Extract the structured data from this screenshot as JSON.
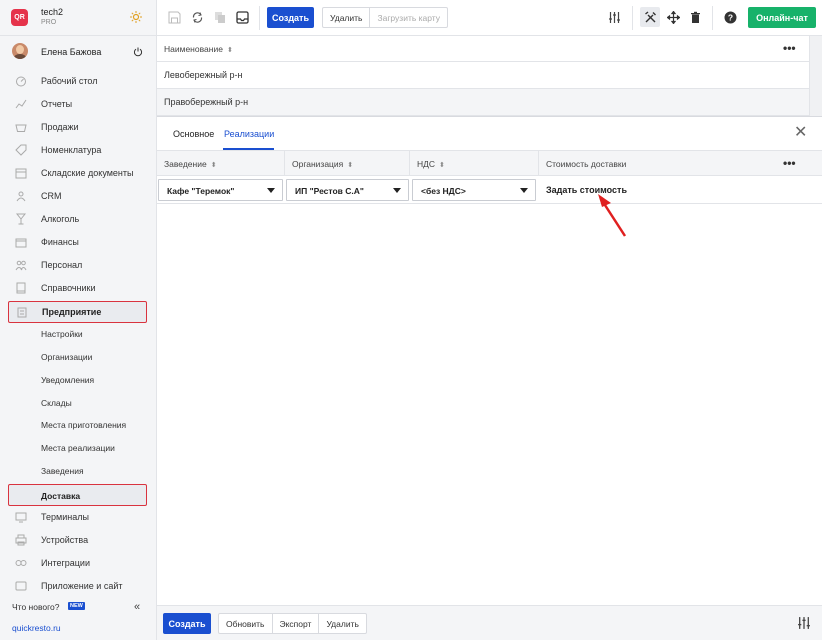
{
  "brand": {
    "logo_text": "QR",
    "name": "tech2",
    "plan": "PRO"
  },
  "user": {
    "name": "Елена Бажова"
  },
  "sidebar": {
    "items": [
      {
        "label": "Рабочий стол",
        "icon": "dashboard-icon"
      },
      {
        "label": "Отчеты",
        "icon": "reports-icon"
      },
      {
        "label": "Продажи",
        "icon": "basket-icon"
      },
      {
        "label": "Номенклатура",
        "icon": "tag-icon"
      },
      {
        "label": "Складские документы",
        "icon": "warehouse-icon"
      },
      {
        "label": "CRM",
        "icon": "people-icon"
      },
      {
        "label": "Алкоголь",
        "icon": "glass-icon"
      },
      {
        "label": "Финансы",
        "icon": "wallet-icon"
      },
      {
        "label": "Персонал",
        "icon": "staff-icon"
      },
      {
        "label": "Справочники",
        "icon": "book-icon"
      },
      {
        "label": "Предприятие",
        "icon": "building-icon"
      }
    ],
    "subitems": [
      {
        "label": "Настройки"
      },
      {
        "label": "Организации"
      },
      {
        "label": "Уведомления"
      },
      {
        "label": "Склады"
      },
      {
        "label": "Места приготовления"
      },
      {
        "label": "Места реализации"
      },
      {
        "label": "Заведения"
      },
      {
        "label": "Доставка"
      }
    ],
    "bottom_items": [
      {
        "label": "Терминалы",
        "icon": "terminal-icon"
      },
      {
        "label": "Устройства",
        "icon": "printer-icon"
      },
      {
        "label": "Интеграции",
        "icon": "link-icon"
      },
      {
        "label": "Приложение и сайт",
        "icon": "app-icon"
      }
    ],
    "whats_new": "Что нового?",
    "new_badge": "NEW",
    "site_link": "quickresto.ru"
  },
  "toolbar": {
    "create_label": "Создать",
    "delete_label": "Удалить",
    "upload_map_label": "Загрузить карту",
    "chat_label": "Онлайн-чат"
  },
  "list": {
    "column_header": "Наименование",
    "rows": [
      "Левобережный р-н",
      "Правобережный р-н"
    ]
  },
  "detail": {
    "tabs": [
      "Основное",
      "Реализации"
    ],
    "active_tab": "Реализации",
    "columns": [
      "Заведение",
      "Организация",
      "НДС",
      "Стоимость доставки"
    ],
    "row": {
      "venue": "Кафе \"Теремок\"",
      "organization": "ИП \"Рестов С.А\"",
      "vat": "<без НДС>",
      "delivery_cost": "Задать стоимость"
    }
  },
  "bottom_bar": {
    "create_label": "Создать",
    "refresh_label": "Обновить",
    "export_label": "Экспорт",
    "delete_label": "Удалить"
  },
  "colors": {
    "primary": "#1a4fd0",
    "chat": "#17b26a",
    "highlight_border": "#d9333f",
    "logo": "#e5334b"
  }
}
